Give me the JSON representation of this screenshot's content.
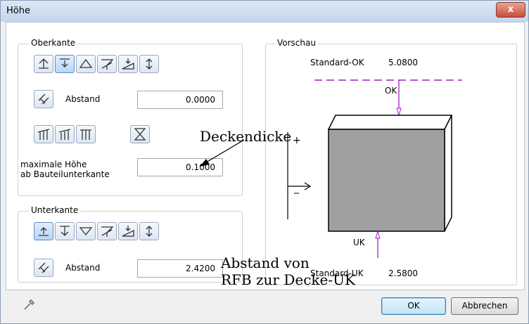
{
  "window": {
    "title": "Höhe",
    "close_glyph": "x"
  },
  "oberkante": {
    "label": "Oberkante",
    "abstand_label": "Abstand",
    "abstand_value": "0.0000",
    "maxhoehe_label1": "maximale Höhe",
    "maxhoehe_label2": "ab Bauteilunterkante",
    "maxhoehe_value": "0.1000"
  },
  "unterkante": {
    "label": "Unterkante",
    "abstand_label": "Abstand",
    "abstand_value": "2.4200"
  },
  "vorschau": {
    "label": "Vorschau",
    "std_ok_label": "Standard-OK",
    "std_ok_value": "5.0800",
    "ok_marker": "OK",
    "uk_marker": "UK",
    "std_uk_label": "Standard-UK",
    "std_uk_value": "2.5800",
    "plus_sign": "+",
    "minus_sign": "_"
  },
  "annotations": {
    "deckendicke": "Deckendicke",
    "abstand_line1": "Abstand von",
    "abstand_line2": "RFB zur Decke-UK"
  },
  "buttons": {
    "ok": "OK",
    "cancel": "Abbrechen"
  },
  "colors": {
    "accent_purple": "#a020c0",
    "box_fill": "#a0a0a0",
    "title_bg": "#c4d6ec"
  }
}
